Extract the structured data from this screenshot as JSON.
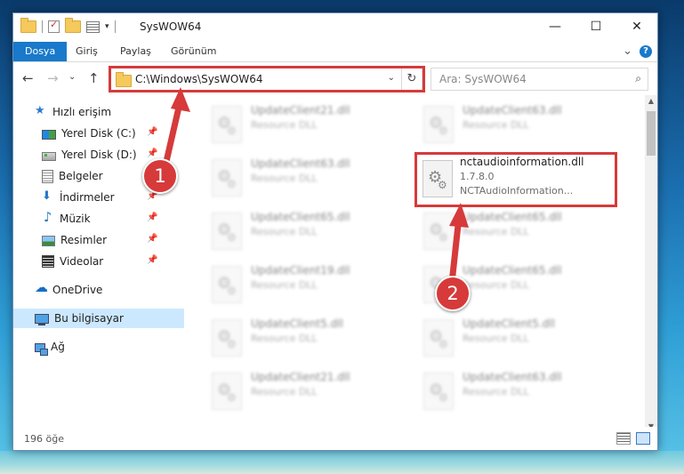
{
  "window": {
    "title": "SysWOW64",
    "controls": [
      "—",
      "☐",
      "✕"
    ]
  },
  "ribbon": {
    "tabs": [
      "Dosya",
      "Giriş",
      "Paylaş",
      "Görünüm"
    ],
    "expand_glyph": "⌄",
    "help_glyph": "?"
  },
  "nav": {
    "back": "←",
    "forward": "→",
    "down": "⌄",
    "up": "↑",
    "address": "C:\\Windows\\SysWOW64",
    "address_drop": "⌄",
    "refresh": "↻",
    "search_placeholder": "Ara: SysWOW64",
    "search_glyph": "⌕"
  },
  "sidebar": {
    "items": [
      {
        "label": "Hızlı erişim",
        "icon": "star-icon"
      },
      {
        "label": "Yerel Disk (C:)",
        "icon": "disk-c-icon",
        "pinned": true
      },
      {
        "label": "Yerel Disk (D:)",
        "icon": "disk-d-icon",
        "pinned": true
      },
      {
        "label": "Belgeler",
        "icon": "documents-icon",
        "pinned": true
      },
      {
        "label": "İndirmeler",
        "icon": "downloads-icon",
        "pinned": true
      },
      {
        "label": "Müzik",
        "icon": "music-icon",
        "pinned": true
      },
      {
        "label": "Resimler",
        "icon": "pictures-icon",
        "pinned": true
      },
      {
        "label": "Videolar",
        "icon": "videos-icon",
        "pinned": true
      },
      {
        "label": "OneDrive",
        "icon": "onedrive-icon"
      },
      {
        "label": "Bu bilgisayar",
        "icon": "this-pc-icon",
        "selected": true
      },
      {
        "label": "Ağ",
        "icon": "network-icon"
      }
    ],
    "pin_glyph": "📌"
  },
  "files": {
    "left": [
      {
        "name": "UpdateClient21.dll",
        "type": "Resource DLL"
      },
      {
        "name": "UpdateClient63.dll",
        "type": "Resource DLL"
      },
      {
        "name": "UpdateClient65.dll",
        "type": "Resource DLL"
      },
      {
        "name": "UpdateClient19.dll",
        "type": "Resource DLL"
      },
      {
        "name": "UpdateClient5.dll",
        "type": "Resource DLL"
      },
      {
        "name": "UpdateClient21.dll",
        "type": "Resource DLL"
      }
    ],
    "right": [
      {
        "name": "UpdateClient63.dll",
        "type": "Resource DLL"
      },
      {
        "name": "nctaudioinformation.dll",
        "version": "1.7.8.0",
        "description": "NCTAudioInformation...",
        "highlighted": true
      },
      {
        "name": "UpdateClient65.dll",
        "type": "Resource DLL"
      },
      {
        "name": "UpdateClient65.dll",
        "type": "Resource DLL"
      },
      {
        "name": "UpdateClient5.dll",
        "type": "Resource DLL"
      },
      {
        "name": "UpdateClient63.dll",
        "type": "Resource DLL"
      }
    ]
  },
  "status": {
    "item_count": "196 öğe"
  },
  "callouts": [
    "1",
    "2"
  ],
  "colors": {
    "accent": "#1979ca",
    "highlight": "#d63a3a",
    "selected": "#cce8ff"
  }
}
